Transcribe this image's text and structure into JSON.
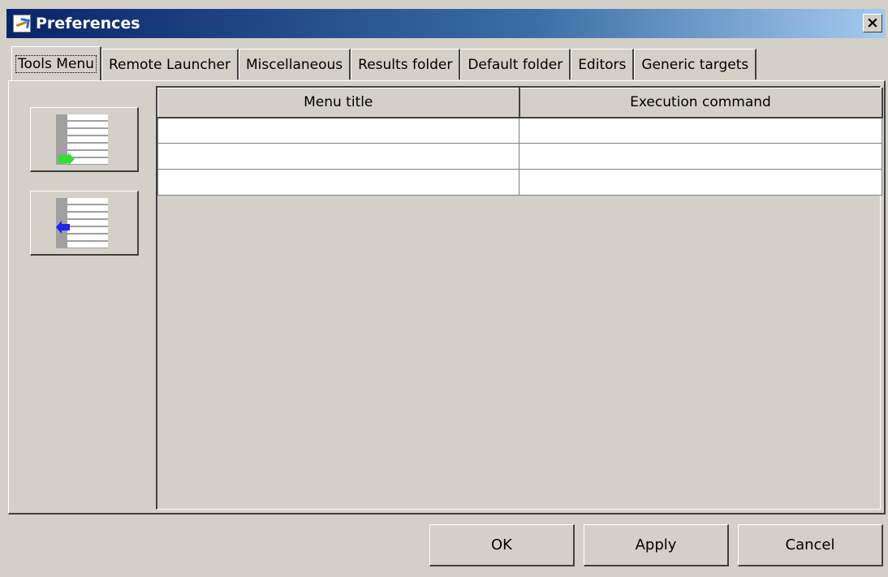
{
  "window": {
    "title": "Preferences",
    "close_label": "×"
  },
  "tabs": [
    {
      "label": "Tools Menu",
      "active": true
    },
    {
      "label": "Remote Launcher",
      "active": false
    },
    {
      "label": "Miscellaneous",
      "active": false
    },
    {
      "label": "Results folder",
      "active": false
    },
    {
      "label": "Default folder",
      "active": false
    },
    {
      "label": "Editors",
      "active": false
    },
    {
      "label": "Generic targets",
      "active": false
    }
  ],
  "side_buttons": [
    {
      "icon": "add-row-icon",
      "arrow_color": "#33dd33"
    },
    {
      "icon": "remove-row-icon",
      "arrow_color": "#2222ee"
    }
  ],
  "grid": {
    "columns": [
      "Menu title",
      "Execution command"
    ],
    "rows": [
      [
        "",
        ""
      ],
      [
        "",
        ""
      ],
      [
        "",
        ""
      ]
    ]
  },
  "footer": {
    "ok_label": "OK",
    "apply_label": "Apply",
    "cancel_label": "Cancel"
  },
  "colors": {
    "face": "#d4d0c8",
    "titlebar_start": "#0a246a",
    "titlebar_end": "#a6caf0"
  }
}
